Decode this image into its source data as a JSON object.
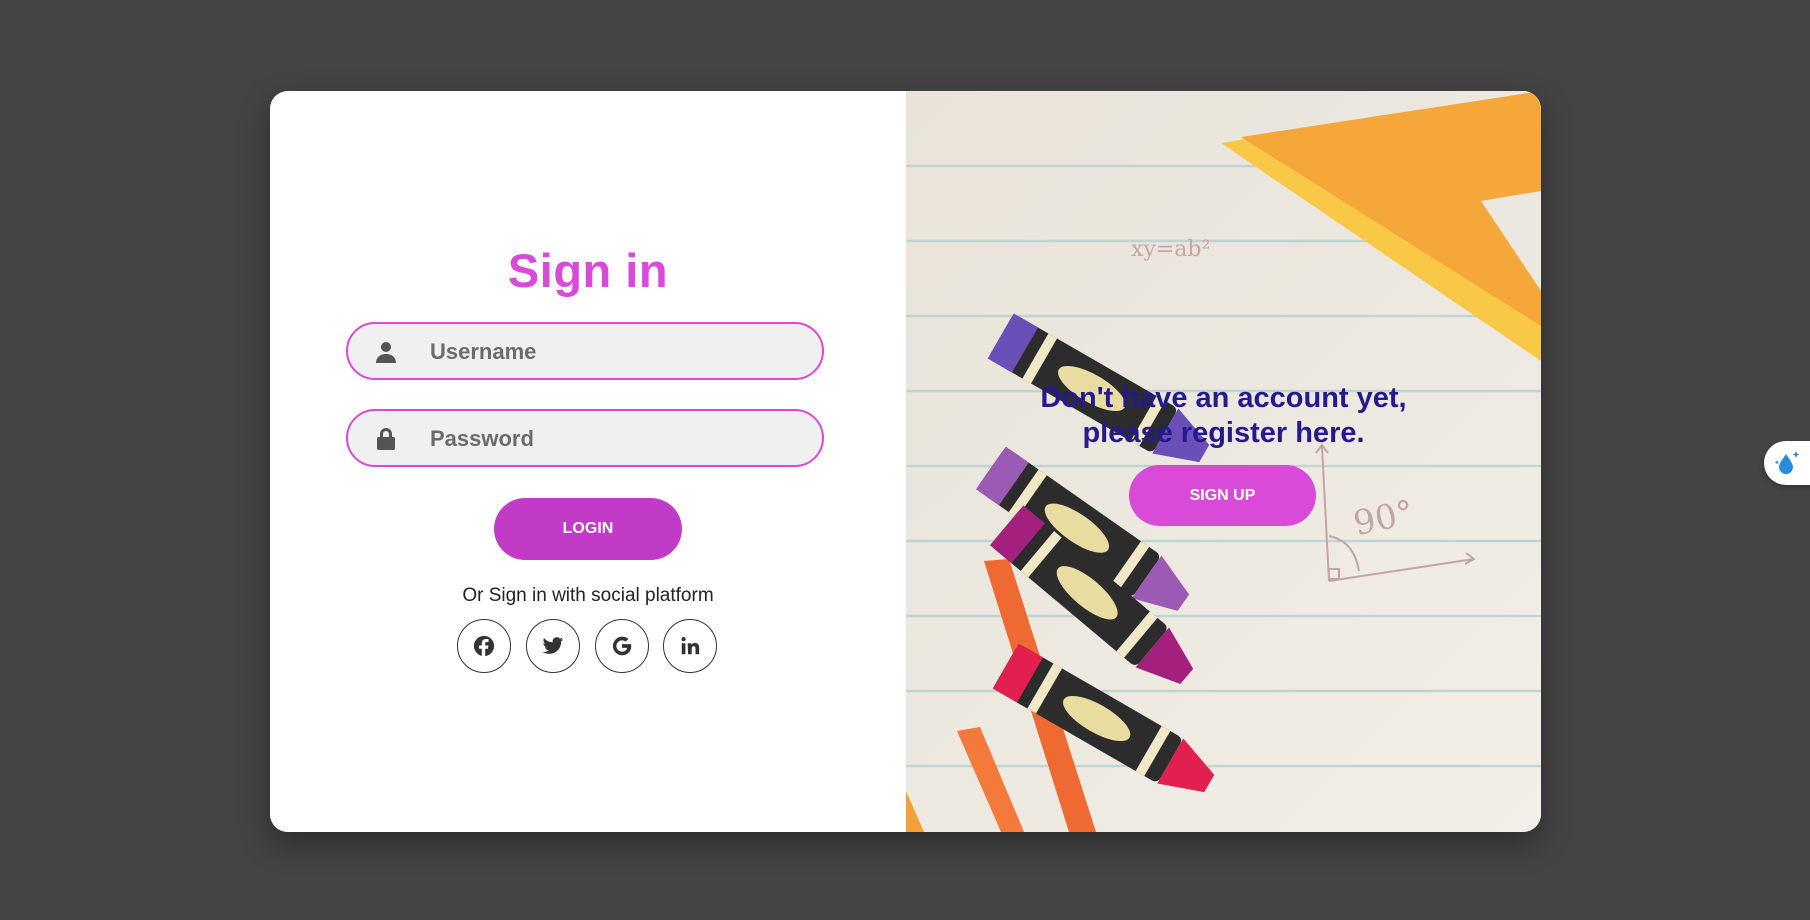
{
  "signin": {
    "title": "Sign in",
    "username_placeholder": "Username",
    "password_placeholder": "Password",
    "login_label": "LOGIN",
    "social_text": "Or Sign in with social platform",
    "social": [
      "facebook-icon",
      "twitter-icon",
      "google-icon",
      "linkedin-icon"
    ]
  },
  "register": {
    "line1": "Don't have an account yet,",
    "line2": "please register here.",
    "signup_label": "SIGN UP"
  },
  "illustration": {
    "formula": "xy=ab²",
    "angle": "90°"
  },
  "colors": {
    "accent": "#d94ad8",
    "login_button": "#c23bc6",
    "register_text": "#25198f",
    "background": "#444444"
  },
  "extension": {
    "icon": "water-drop-sparkle-icon"
  }
}
